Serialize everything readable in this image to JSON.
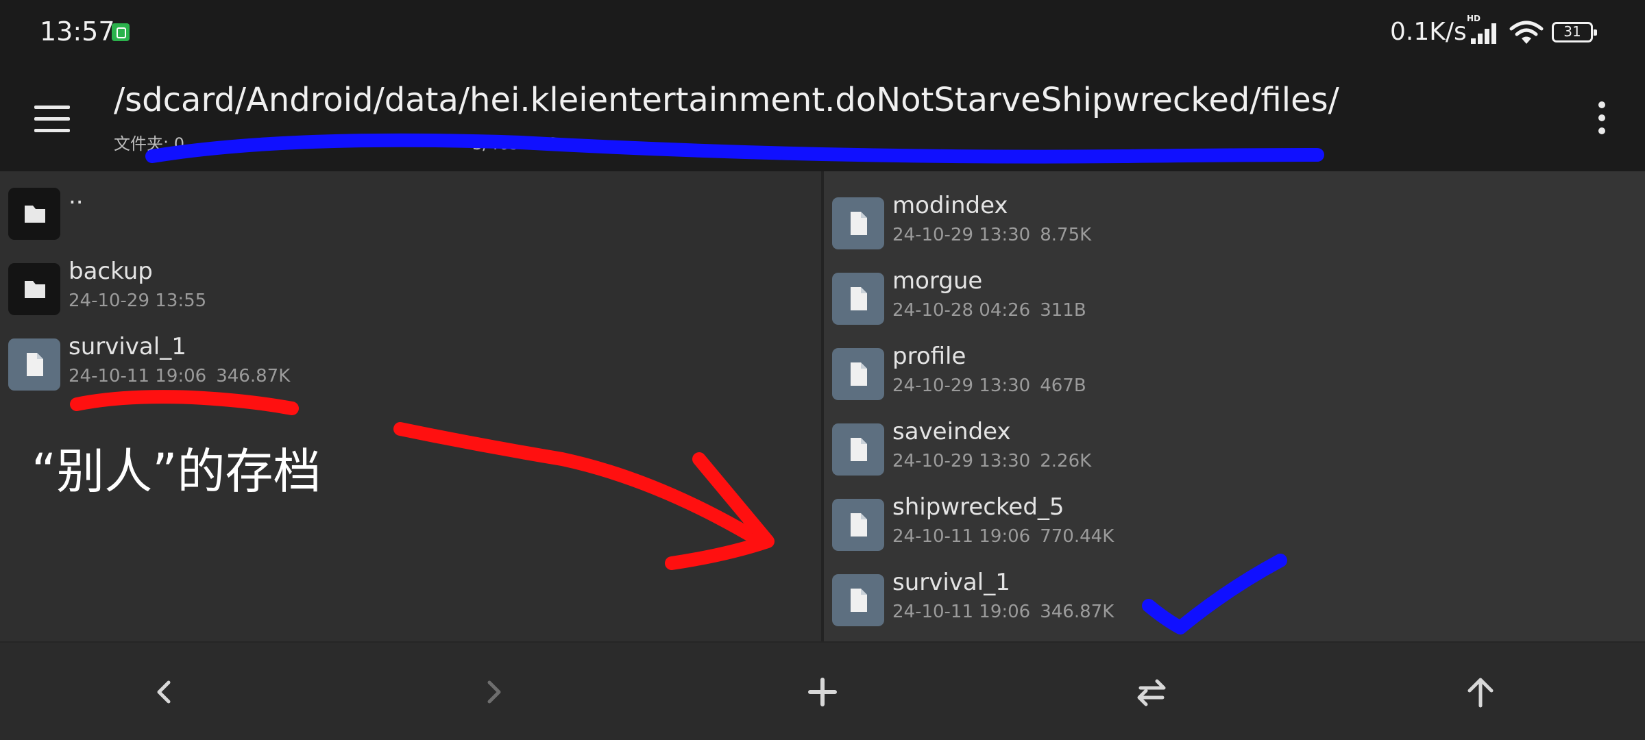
{
  "status_bar": {
    "time": "13:57",
    "network_speed": "0.1K/s",
    "network_badge": "HD",
    "battery_level": "31",
    "notification_icon": "app-notification-icon",
    "signal_icon": "signal-icon",
    "wifi_icon": "wifi-icon",
    "battery_icon": "battery-icon"
  },
  "toolbar": {
    "menu_icon": "hamburger-menu-icon",
    "path": "/sdcard/Android/data/hei.kleientertainment.doNotStarveShipwrecked/files/",
    "subtitle_prefix": "文件夹: 0",
    "subtitle_suffix": "3/465.26G",
    "overflow_icon": "more-vertical-icon"
  },
  "left_pane": {
    "items": [
      {
        "name": "..",
        "type": "folder",
        "date": "",
        "size": ""
      },
      {
        "name": "backup",
        "type": "folder",
        "date": "24-10-29 13:55",
        "size": ""
      },
      {
        "name": "survival_1",
        "type": "file",
        "date": "24-10-11 19:06",
        "size": "346.87K"
      }
    ],
    "annotation": "“别人”的存档"
  },
  "right_pane": {
    "items": [
      {
        "name": "modindex",
        "type": "file",
        "date": "24-10-29 13:30",
        "size": "8.75K"
      },
      {
        "name": "morgue",
        "type": "file",
        "date": "24-10-28 04:26",
        "size": "311B"
      },
      {
        "name": "profile",
        "type": "file",
        "date": "24-10-29 13:30",
        "size": "467B"
      },
      {
        "name": "saveindex",
        "type": "file",
        "date": "24-10-29 13:30",
        "size": "2.26K"
      },
      {
        "name": "shipwrecked_5",
        "type": "file",
        "date": "24-10-11 19:06",
        "size": "770.44K"
      },
      {
        "name": "survival_1",
        "type": "file",
        "date": "24-10-11 19:06",
        "size": "346.87K"
      }
    ]
  },
  "bottom_bar": {
    "buttons": [
      "back-icon",
      "forward-icon",
      "add-icon",
      "swap-panes-icon",
      "parent-folder-icon"
    ]
  },
  "colors": {
    "annotation_blue": "#1010ff",
    "annotation_red": "#ff1010",
    "file_icon_bg": "#5d6f80",
    "folder_icon_bg": "#141414"
  }
}
